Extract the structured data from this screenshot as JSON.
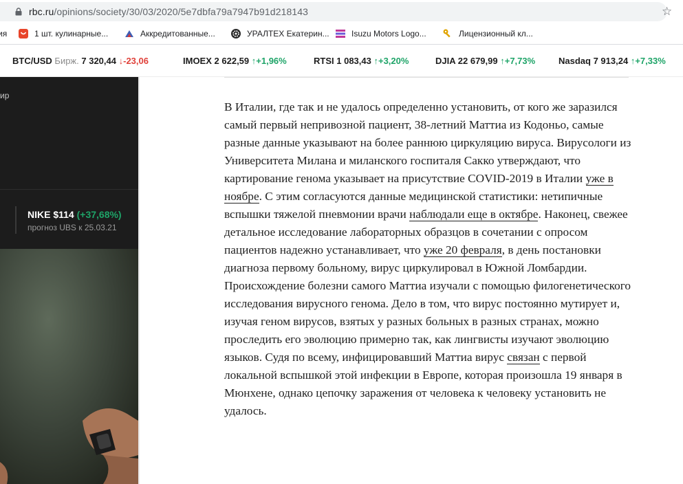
{
  "browser": {
    "url_host": "rbc.ru",
    "url_path": "/opinions/society/30/03/2020/5e7dbfa79a7947b91d218143"
  },
  "bookmarks": [
    {
      "label": "ия",
      "icon": "folder-icon"
    },
    {
      "label": "1 шт. кулинарные...",
      "icon": "aliexpress-icon"
    },
    {
      "label": "Аккредитованные...",
      "icon": "site-icon"
    },
    {
      "label": "УРАЛТЕХ Екатерин...",
      "icon": "gear-icon"
    },
    {
      "label": "Isuzu Motors Logo...",
      "icon": "isuzu-icon"
    },
    {
      "label": "Лицензионный кл...",
      "icon": "key-icon"
    }
  ],
  "ticker": [
    {
      "name": "BTC/USD",
      "source": "Бирж.",
      "value": "7 320,44",
      "change": "-23,06",
      "direction": "down"
    },
    {
      "name": "IMOEX",
      "value": "2 622,59",
      "change": "+1,96%",
      "direction": "up"
    },
    {
      "name": "RTSI",
      "value": "1 083,43",
      "change": "+3,20%",
      "direction": "up"
    },
    {
      "name": "DJIA",
      "value": "22 679,99",
      "change": "+7,73%",
      "direction": "up"
    },
    {
      "name": "Nasdaq",
      "value": "7 913,24",
      "change": "+7,33%",
      "direction": "up"
    }
  ],
  "sidebar": {
    "fragment": "ир",
    "quote_title": "NIKE $114",
    "quote_change": "(+37,68%)",
    "quote_sub": "прогноз UBS к 25.03.21"
  },
  "article": {
    "t1": "В Италии, где так и не удалось определенно установить, от кого же заразился самый первый непривозной пациент, 38-летний Маттиа из Кодоньо, самые разные данные указывают на более раннюю циркуляцию вируса. Вирусологи из Университета Милана и миланского госпиталя Сакко утверждают, что картирование генома указывает на присутствие COVID-2019 в Италии ",
    "l1": "уже в ноябре",
    "t2": ". С этим согласуются данные медицинской статистики: нетипичные вспышки тяжелой пневмонии врачи ",
    "l2": "наблюдали еще в октябре",
    "t3": ". Наконец, свежее детальное исследование лабораторных образцов в сочетании с опросом пациентов надежно устанавливает, что ",
    "l3": "уже 20 февраля",
    "t4": ", в день постановки диагноза первому больному, вирус циркулировал в Южной Ломбардии. Происхождение болезни самого Маттиа изучали с помощью филогенетического исследования вирусного генома. Дело в том, что вирус постоянно мутирует и, изучая геном вирусов, взятых у разных больных в разных странах, можно проследить его эволюцию примерно так, как лингвисты изучают эволюцию языков. Судя по всему, инфицировавший Маттиа вирус ",
    "l4": "связан",
    "t5": " с первой локальной вспышкой этой инфекции в Европе, которая произошла 19 января в Мюнхене, однако цепочку заражения от человека к человеку установить не удалось."
  },
  "colors": {
    "up": "#1ea468",
    "down": "#e0413a",
    "sidebar_bg": "#1c1c1c"
  }
}
